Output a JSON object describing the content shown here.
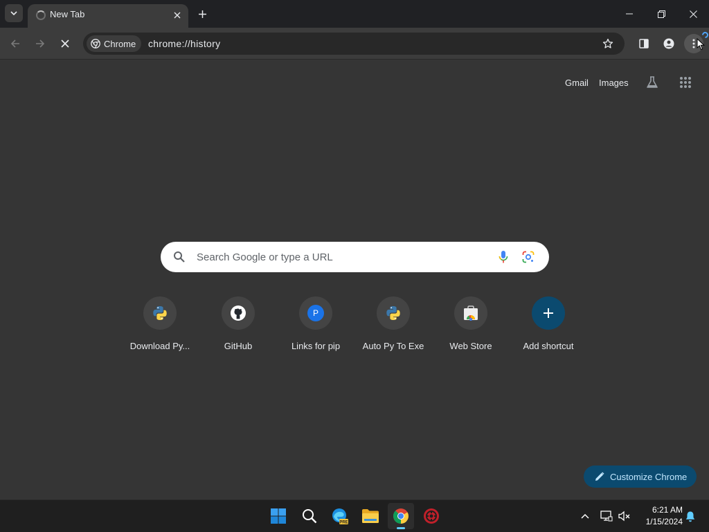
{
  "browser": {
    "tab": {
      "title": "New Tab"
    },
    "omnibox": {
      "chip_label": "Chrome",
      "url": "chrome://history"
    }
  },
  "ntp": {
    "top_links": {
      "gmail": "Gmail",
      "images": "Images"
    },
    "search": {
      "placeholder": "Search Google or type a URL"
    },
    "shortcuts": [
      {
        "label": "Download Py...",
        "icon": "python-icon"
      },
      {
        "label": "GitHub",
        "icon": "github-icon"
      },
      {
        "label": "Links for pip",
        "icon": "letter-p-icon",
        "letter": "P"
      },
      {
        "label": "Auto Py To Exe",
        "icon": "python-icon"
      },
      {
        "label": "Web Store",
        "icon": "web-store-icon"
      },
      {
        "label": "Add shortcut",
        "icon": "plus-icon"
      }
    ],
    "customize": {
      "label": "Customize Chrome"
    }
  },
  "taskbar": {
    "apps": [
      "windows-start-icon",
      "search-icon",
      "edge-preview-icon",
      "file-explorer-icon",
      "chrome-icon",
      "app-icon"
    ],
    "clock": {
      "time": "6:21 AM",
      "date": "1/15/2024"
    }
  },
  "colors": {
    "page_bg": "#353535",
    "toolbar_bg": "#3c3c3c",
    "tabstrip_bg": "#202124",
    "accent": "#0b4a6f",
    "accent_text": "#c2e7ff"
  }
}
